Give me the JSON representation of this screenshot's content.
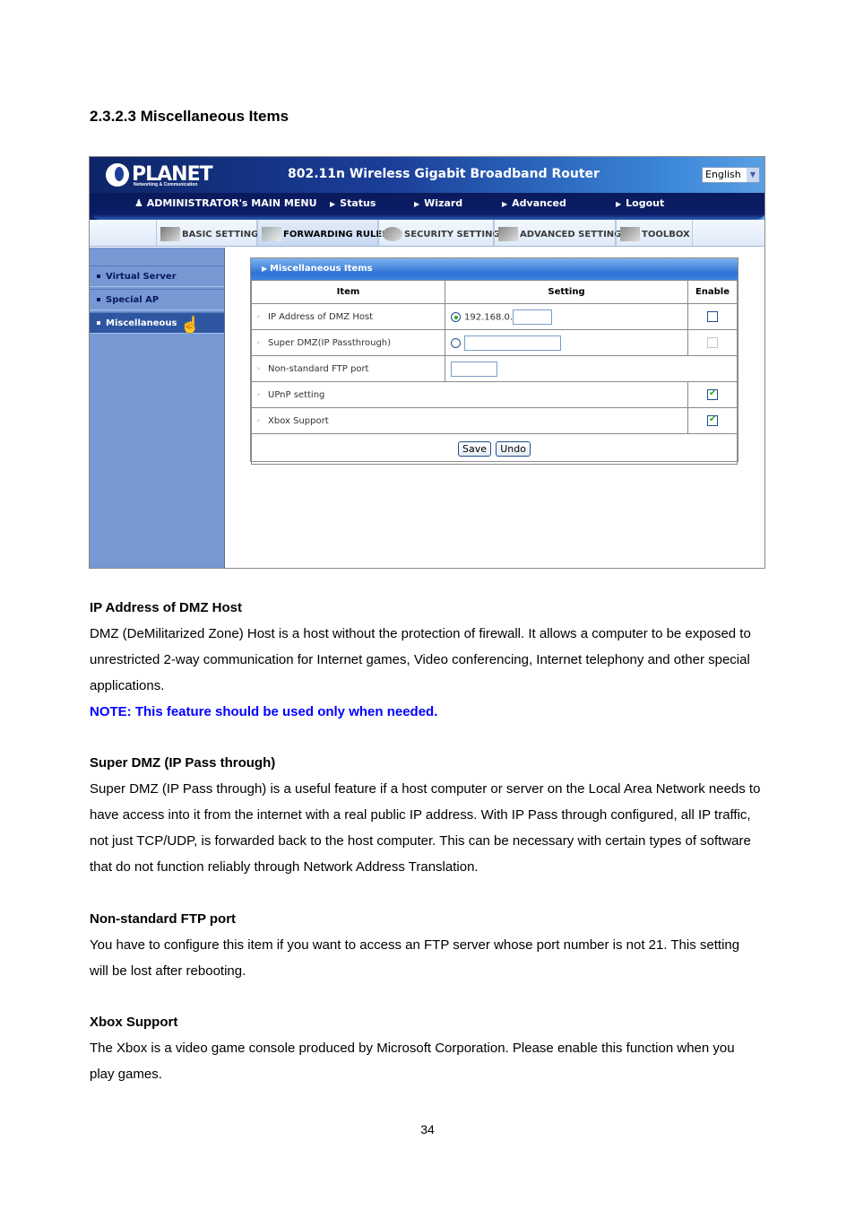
{
  "section_title": "2.3.2.3 Miscellaneous Items",
  "router": {
    "brand": "PLANET",
    "brand_sub": "Networking & Communication",
    "title": "802.11n Wireless Gigabit Broadband Router",
    "language": "English",
    "nav": {
      "main_menu": "ADMINISTRATOR's MAIN MENU",
      "items": [
        "Status",
        "Wizard",
        "Advanced",
        "Logout"
      ]
    },
    "tabs": [
      "BASIC SETTING",
      "FORWARDING RULES",
      "SECURITY SETTING",
      "ADVANCED SETTING",
      "TOOLBOX"
    ],
    "active_tab": "FORWARDING RULES",
    "sidebar": [
      "Virtual Server",
      "Special AP",
      "Miscellaneous"
    ],
    "active_sidebar": "Miscellaneous",
    "panel": {
      "title": "Miscellaneous Items",
      "headers": {
        "item": "Item",
        "setting": "Setting",
        "enable": "Enable"
      },
      "rows": [
        {
          "item": "IP Address of DMZ Host",
          "ip_prefix": "192.168.0.",
          "value": "",
          "radio_selected": true,
          "enabled": false
        },
        {
          "item": "Super DMZ(IP Passthrough)",
          "value": "",
          "radio_selected": false,
          "enabled": false,
          "enable_disabled": true
        },
        {
          "item": "Non-standard FTP port",
          "value": ""
        },
        {
          "item": "UPnP setting",
          "enabled": true
        },
        {
          "item": "Xbox Support",
          "enabled": true
        }
      ],
      "save_label": "Save",
      "undo_label": "Undo"
    }
  },
  "doc": {
    "dmz": {
      "heading": "IP Address of DMZ Host",
      "body": "DMZ (DeMilitarized Zone) Host is a host without the protection of firewall. It allows a computer to be exposed to unrestricted 2-way communication for Internet games, Video conferencing, Internet telephony and other special applications.",
      "note": "NOTE: This feature should be used only when needed."
    },
    "super_dmz": {
      "heading": "Super DMZ (IP Pass through)",
      "body": "Super DMZ (IP Pass through) is a useful feature if a host computer or server on the Local Area Network needs to have access into it from the internet with a real public IP address. With IP Pass through configured, all IP traffic, not just TCP/UDP, is forwarded back to the host computer. This can be necessary with certain types of software that do not function reliably through Network Address Translation."
    },
    "ftp": {
      "heading": "Non-standard FTP port",
      "body": "You have to configure this item if you want to access an FTP server whose port number is not 21. This setting will be lost after rebooting."
    },
    "xbox": {
      "heading": "Xbox Support",
      "body": "The Xbox is a video game console produced by Microsoft Corporation. Please enable this function when you play games."
    }
  },
  "page_number": "34"
}
